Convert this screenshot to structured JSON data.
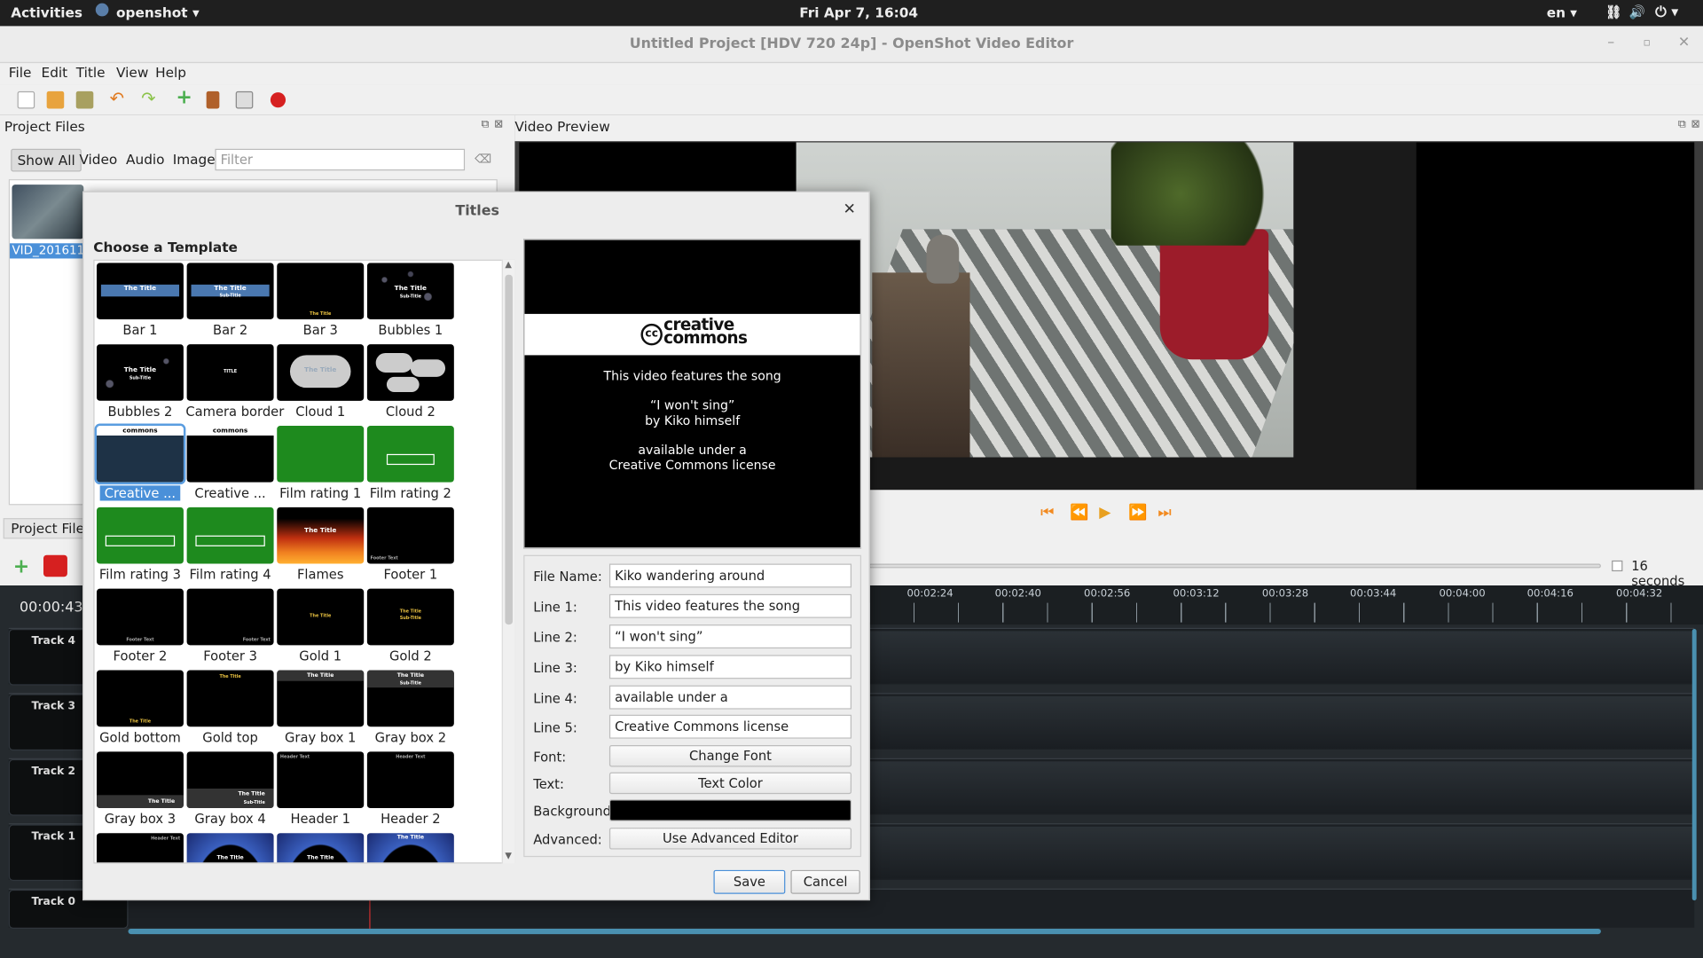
{
  "topbar": {
    "activities": "Activities",
    "app": "openshot ▾",
    "clock": "Fri Apr  7, 16:04",
    "lang": "en ▾"
  },
  "window": {
    "title": "Untitled Project [HDV 720 24p] - OpenShot Video Editor"
  },
  "menu": [
    "File",
    "Edit",
    "Title",
    "View",
    "Help"
  ],
  "project_files": {
    "title": "Project Files",
    "tabs": [
      "Show All",
      "Video",
      "Audio",
      "Image"
    ],
    "filter_placeholder": "Filter",
    "file_name": "VID_201611..."
  },
  "video_preview": {
    "title": "Video Preview"
  },
  "timeline": {
    "pane_tab": "Project Files",
    "current_time": "00:00:43:",
    "zoom": "16 seconds",
    "ruler": [
      "00:02:24",
      "00:02:40",
      "00:02:56",
      "00:03:12",
      "00:03:28",
      "00:03:44",
      "00:04:00",
      "00:04:16",
      "00:04:32"
    ],
    "tracks": [
      "Track 4",
      "Track 3",
      "Track 2",
      "Track 1",
      "Track 0"
    ]
  },
  "dialog": {
    "title": "Titles",
    "choose_label": "Choose a Template",
    "templates": [
      "Bar 1",
      "Bar 2",
      "Bar 3",
      "Bubbles 1",
      "Bubbles 2",
      "Camera border",
      "Cloud 1",
      "Cloud 2",
      "Creative ...",
      "Creative ...",
      "Film rating 1",
      "Film rating 2",
      "Film rating 3",
      "Film rating 4",
      "Flames",
      "Footer 1",
      "Footer 2",
      "Footer 3",
      "Gold 1",
      "Gold 2",
      "Gold bottom",
      "Gold top",
      "Gray box 1",
      "Gray box 2",
      "Gray box 3",
      "Gray box 4",
      "Header 1",
      "Header 2"
    ],
    "thumb_text": {
      "title": "The Title",
      "subtitle": "Sub-Title",
      "caps": "TITLE",
      "footer": "Footer Text",
      "header": "Header Text"
    },
    "preview": {
      "logo_line1": "creative",
      "logo_line2": "commons",
      "cc": "cc",
      "lines": [
        "This video features the song",
        "“I won't sing”",
        "by Kiko himself",
        "available under a",
        "Creative Commons license"
      ]
    },
    "form": {
      "file_name_label": "File Name:",
      "file_name": "Kiko wandering around",
      "line_labels": [
        "Line 1:",
        "Line 2:",
        "Line 3:",
        "Line 4:",
        "Line 5:"
      ],
      "lines": [
        "This video features the song",
        "“I won't sing”",
        "by Kiko himself",
        "available under a",
        "Creative Commons license"
      ],
      "font_label": "Font:",
      "font_button": "Change Font",
      "text_label": "Text:",
      "text_button": "Text Color",
      "bg_label": "Background:",
      "advanced_label": "Advanced:",
      "advanced_button": "Use Advanced Editor"
    },
    "save": "Save",
    "cancel": "Cancel"
  },
  "colors": {
    "accent": "#4a90d9",
    "record": "#e02020",
    "play": "#f0a000"
  }
}
